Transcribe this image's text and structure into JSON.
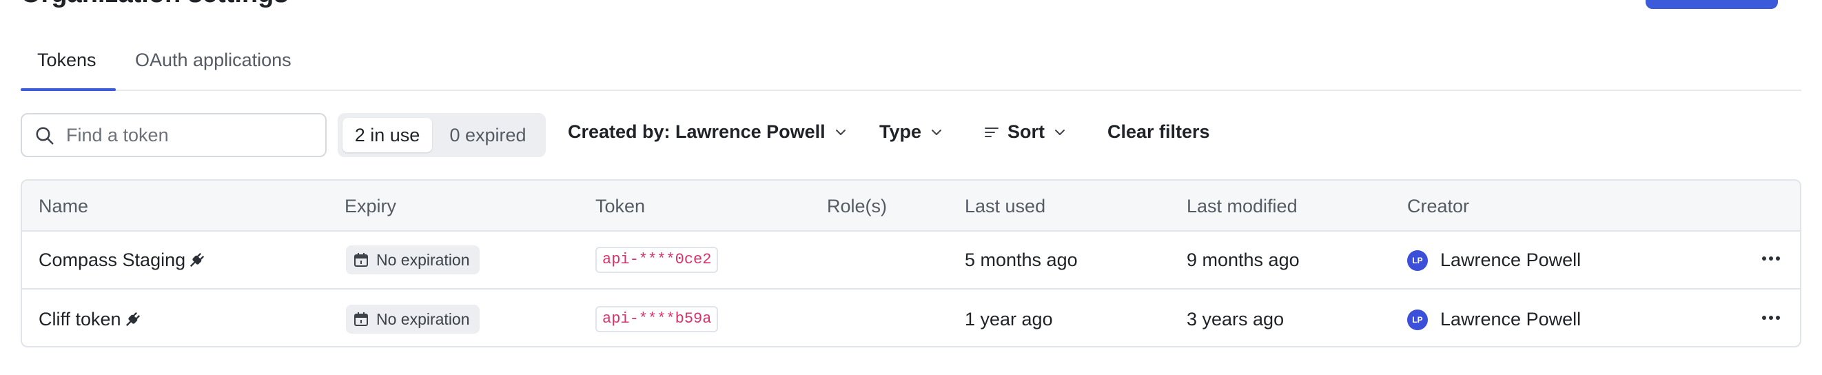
{
  "page": {
    "title": "Organization settings"
  },
  "tabs": [
    {
      "label": "Tokens",
      "active": true
    },
    {
      "label": "OAuth applications",
      "active": false
    }
  ],
  "filters": {
    "search_placeholder": "Find a token",
    "search_value": "",
    "in_use_label": "2 in use",
    "expired_label": "0 expired",
    "created_by_label": "Created by: Lawrence Powell",
    "type_label": "Type",
    "sort_label": "Sort",
    "clear_label": "Clear filters"
  },
  "table": {
    "columns": [
      "Name",
      "Expiry",
      "Token",
      "Role(s)",
      "Last used",
      "Last modified",
      "Creator"
    ],
    "rows": [
      {
        "name": "Compass Staging",
        "expiry": "No expiration",
        "token": "api-****0ce2",
        "roles": "",
        "last_used": "5 months ago",
        "last_modified": "9 months ago",
        "creator": "Lawrence Powell",
        "creator_initials": "LP"
      },
      {
        "name": "Cliff token",
        "expiry": "No expiration",
        "token": "api-****b59a",
        "roles": "",
        "last_used": "1 year ago",
        "last_modified": "3 years ago",
        "creator": "Lawrence Powell",
        "creator_initials": "LP"
      }
    ]
  },
  "icons": {
    "search": "search-icon",
    "chevron": "chevron-down-icon",
    "sort": "sort-icon",
    "plug": "plug-icon",
    "calendar": "calendar-icon",
    "more": "more-horizontal-icon"
  },
  "colors": {
    "accent": "#3b5bdb",
    "token_text": "#d6336c",
    "avatar": "#3b4fd8"
  }
}
